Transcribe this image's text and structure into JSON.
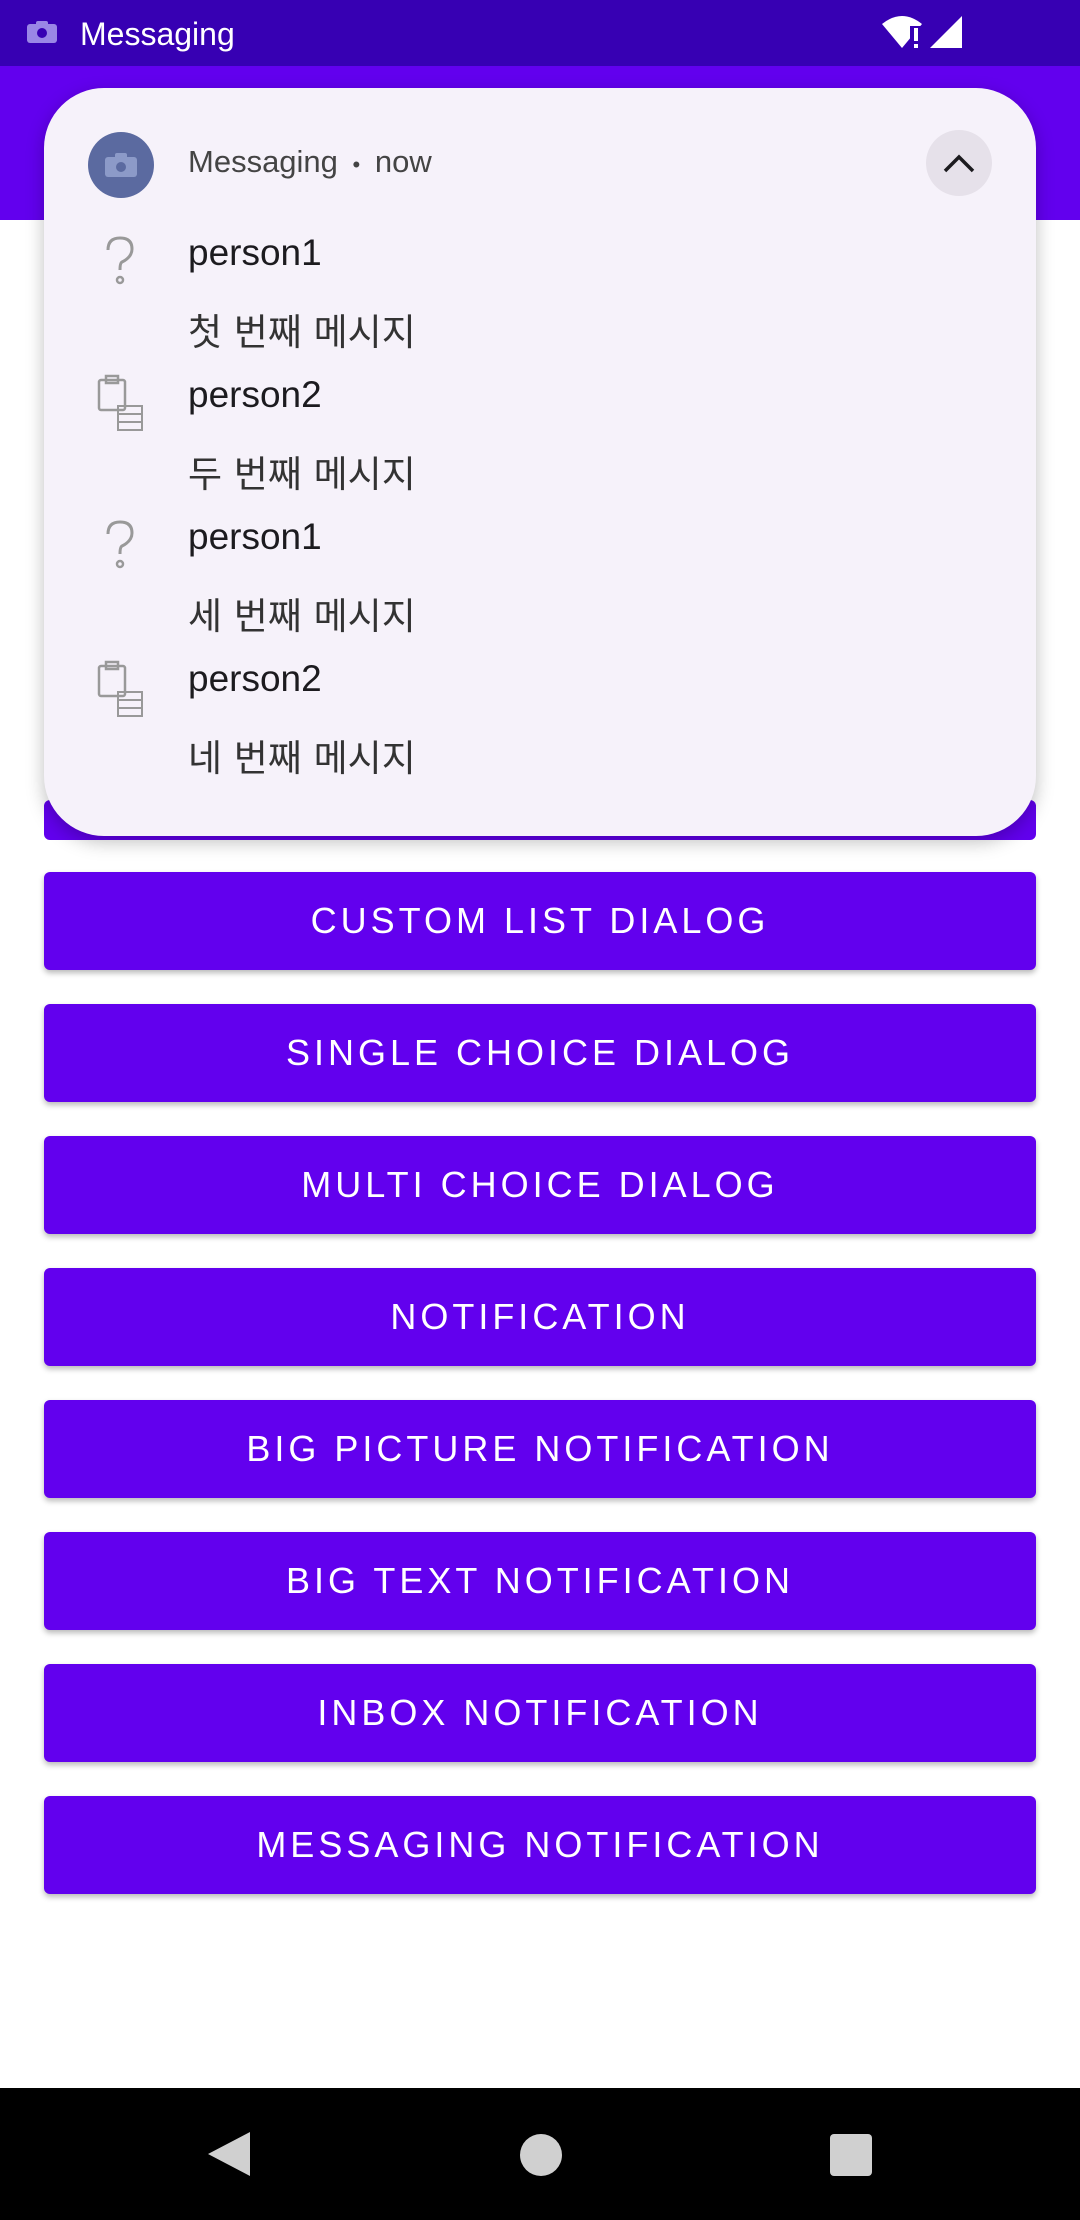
{
  "status_bar": {
    "app_name": "Messaging",
    "icons": [
      "camera-icon",
      "wifi-alert-icon",
      "cell-signal-icon"
    ]
  },
  "notification": {
    "app": "Messaging",
    "time": "now",
    "separator": "•",
    "messages": [
      {
        "name": "person1",
        "text": "첫 번째 메시지",
        "icon": "question-icon"
      },
      {
        "name": "person2",
        "text": "두 번째 메시지",
        "icon": "clipboard-list-icon"
      },
      {
        "name": "person1",
        "text": "세 번째 메시지",
        "icon": "question-icon"
      },
      {
        "name": "person2",
        "text": "네 번째 메시지",
        "icon": "clipboard-list-icon"
      }
    ]
  },
  "buttons": [
    "CUSTOM LIST DIALOG",
    "SINGLE CHOICE DIALOG",
    "MULTI CHOICE DIALOG",
    "NOTIFICATION",
    "BIG PICTURE NOTIFICATION",
    "BIG TEXT NOTIFICATION",
    "INBOX NOTIFICATION",
    "MESSAGING NOTIFICATION"
  ],
  "colors": {
    "status_bar": "#3700b3",
    "primary": "#6200ee",
    "notification_bg": "#f6f2fa",
    "nav_bar": "#000000"
  },
  "nav_bar": [
    "back-icon",
    "home-icon",
    "recents-icon"
  ]
}
